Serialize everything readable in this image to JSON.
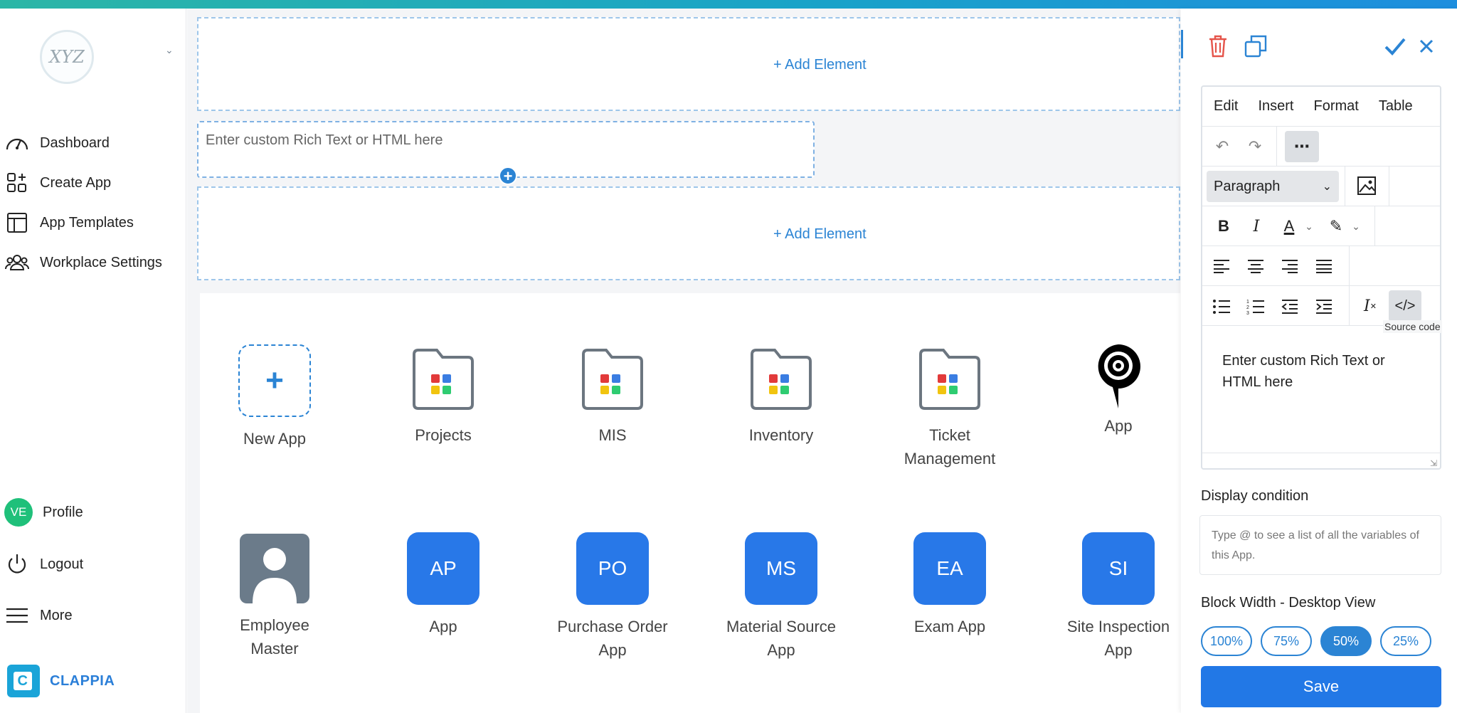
{
  "sidebar": {
    "logo_text": "XYZ",
    "items": [
      {
        "label": "Dashboard",
        "icon": "speedometer-icon"
      },
      {
        "label": "Create App",
        "icon": "grid-plus-icon"
      },
      {
        "label": "App Templates",
        "icon": "template-icon"
      },
      {
        "label": "Workplace Settings",
        "icon": "people-icon"
      }
    ],
    "profile": {
      "initials": "VE",
      "label": "Profile",
      "color": "#1fc07a"
    },
    "logout_label": "Logout",
    "more_label": "More",
    "brand": "CLAPPIA"
  },
  "canvas": {
    "add_element_top": "+ Add Element",
    "rich_text_placeholder": "Enter custom Rich Text or HTML here",
    "add_element_bottom": "+ Add Element",
    "apps_row1": [
      {
        "label": "New App",
        "kind": "new"
      },
      {
        "label": "Projects",
        "kind": "folder"
      },
      {
        "label": "MIS",
        "kind": "folder"
      },
      {
        "label": "Inventory",
        "kind": "folder"
      },
      {
        "label": "Ticket Management",
        "kind": "folder"
      },
      {
        "label": "App",
        "kind": "pin"
      }
    ],
    "apps_row2": [
      {
        "label": "Employee Master",
        "kind": "person"
      },
      {
        "label": "App",
        "badge": "AP"
      },
      {
        "label": "Purchase Order App",
        "badge": "PO"
      },
      {
        "label": "Material Source App",
        "badge": "MS"
      },
      {
        "label": "Exam App",
        "badge": "EA"
      },
      {
        "label": "Site Inspection App",
        "badge": "SI"
      }
    ]
  },
  "panel": {
    "menu": [
      "Edit",
      "Insert",
      "Format",
      "Table"
    ],
    "format_select": "Paragraph",
    "tooltip": "Source code",
    "editor_content": "Enter custom Rich Text or HTML here",
    "display_condition_label": "Display condition",
    "display_condition_placeholder": "Type @ to see a list of all the variables of this App.",
    "block_width_label": "Block Width - Desktop View",
    "width_options": [
      "100%",
      "75%",
      "50%",
      "25%"
    ],
    "width_selected": "50%",
    "save_label": "Save",
    "accent": "#2b84d4"
  }
}
